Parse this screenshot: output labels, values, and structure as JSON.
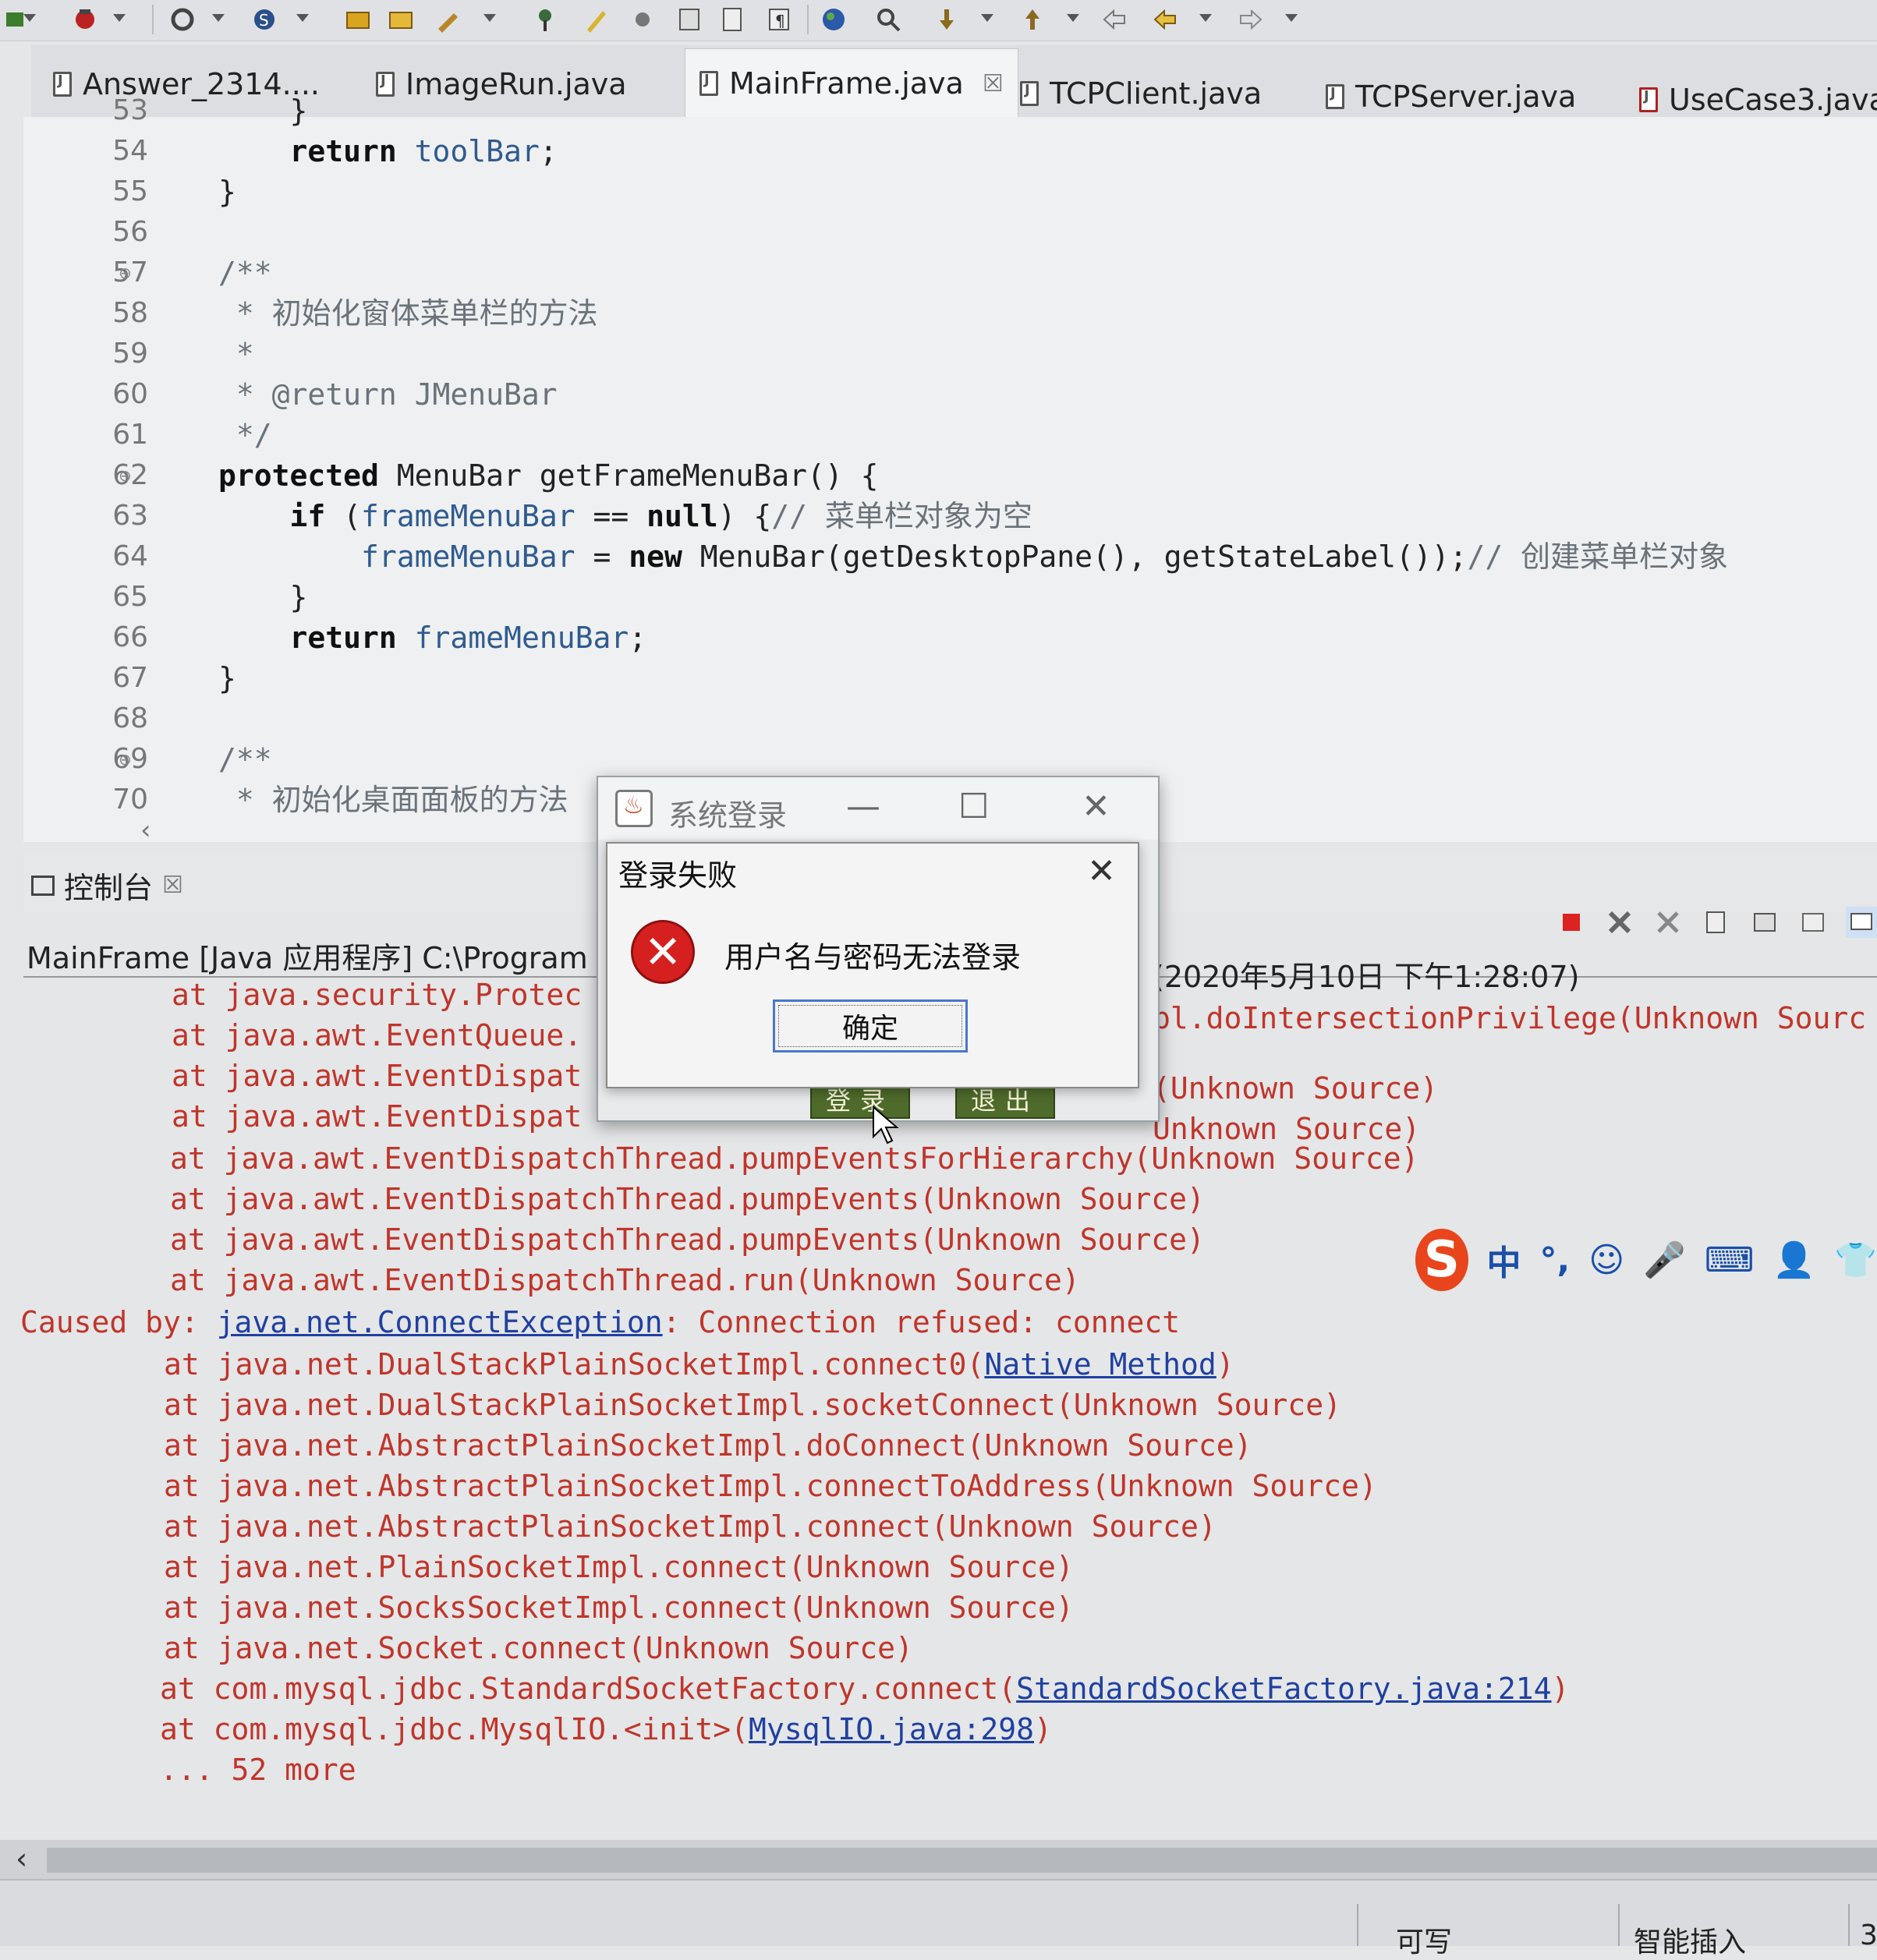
{
  "editor_tabs": [
    {
      "label": "Answer_2314....",
      "active": false
    },
    {
      "label": "ImageRun.java",
      "active": false
    },
    {
      "label": "MainFrame.java",
      "active": true,
      "close": "☒"
    },
    {
      "label": "TCPClient.java",
      "active": false
    },
    {
      "label": "TCPServer.java",
      "active": false
    },
    {
      "label": "UseCase3.java",
      "active": false
    }
  ],
  "code_lines": [
    {
      "n": "53",
      "text": "    }"
    },
    {
      "n": "54",
      "text": "    return toolBar;"
    },
    {
      "n": "55",
      "text": "}"
    },
    {
      "n": "56",
      "text": ""
    },
    {
      "n": "57",
      "text": "/**"
    },
    {
      "n": "58",
      "text": " * 初始化窗体菜单栏的方法"
    },
    {
      "n": "59",
      "text": " *"
    },
    {
      "n": "60",
      "text": " * @return JMenuBar"
    },
    {
      "n": "61",
      "text": " */"
    },
    {
      "n": "62",
      "text": "protected MenuBar getFrameMenuBar() {"
    },
    {
      "n": "63",
      "text": "    if (frameMenuBar == null) {// 菜单栏对象为空"
    },
    {
      "n": "64",
      "text": "        frameMenuBar = new MenuBar(getDesktopPane(), getStateLabel());// 创建菜单栏对象"
    },
    {
      "n": "65",
      "text": "    }"
    },
    {
      "n": "66",
      "text": "    return frameMenuBar;"
    },
    {
      "n": "67",
      "text": "}"
    },
    {
      "n": "68",
      "text": ""
    },
    {
      "n": "69",
      "text": "/**"
    },
    {
      "n": "70",
      "text": " * 初始化桌面面板的方法"
    }
  ],
  "console": {
    "tab_label": "控制台",
    "tab_close": "☒",
    "process_left": "MainFrame [Java 应用程序] C:\\Program",
    "process_right": "(2020年5月10日 下午1:28:07)",
    "lines_top": [
      {
        "left": "at java.security.Protec",
        "right": "pl.doIntersectionPrivilege(Unknown Sourc"
      },
      {
        "left": "at java.awt.EventQueue.",
        "right": ""
      },
      {
        "left": "at java.awt.EventDispat",
        "right": "(Unknown Source)"
      },
      {
        "left": "at java.awt.EventDispat",
        "right": "Unknown Source)"
      }
    ],
    "lines": [
      "at java.awt.EventDispatchThread.pumpEventsForHierarchy(Unknown Source)",
      "at java.awt.EventDispatchThread.pumpEvents(Unknown Source)",
      "at java.awt.EventDispatchThread.pumpEvents(Unknown Source)",
      "at java.awt.EventDispatchThread.run(Unknown Source)"
    ],
    "caused_by": {
      "prefix": "Caused by: ",
      "exception": "java.net.ConnectException",
      "message": ": Connection refused: connect"
    },
    "stack": [
      {
        "text": "at java.net.DualStackPlainSocketImpl.connect0(",
        "link": "Native Method",
        "suffix": ")"
      },
      {
        "text": "at java.net.DualStackPlainSocketImpl.socketConnect(Unknown Source)",
        "link": "",
        "suffix": ""
      },
      {
        "text": "at java.net.AbstractPlainSocketImpl.doConnect(Unknown Source)",
        "link": "",
        "suffix": ""
      },
      {
        "text": "at java.net.AbstractPlainSocketImpl.connectToAddress(Unknown Source)",
        "link": "",
        "suffix": ""
      },
      {
        "text": "at java.net.AbstractPlainSocketImpl.connect(Unknown Source)",
        "link": "",
        "suffix": ""
      },
      {
        "text": "at java.net.PlainSocketImpl.connect(Unknown Source)",
        "link": "",
        "suffix": ""
      },
      {
        "text": "at java.net.SocksSocketImpl.connect(Unknown Source)",
        "link": "",
        "suffix": ""
      },
      {
        "text": "at java.net.Socket.connect(Unknown Source)",
        "link": "",
        "suffix": ""
      },
      {
        "text": "at com.mysql.jdbc.StandardSocketFactory.connect(",
        "link": "StandardSocketFactory.java:214",
        "suffix": ")"
      },
      {
        "text": "at com.mysql.jdbc.MysqlIO.<init>(",
        "link": "MysqlIO.java:298",
        "suffix": ")"
      },
      {
        "text": "... 52 more",
        "link": "",
        "suffix": ""
      }
    ]
  },
  "login_window": {
    "title": "系统登录",
    "minimize": "—",
    "maximize": "☐",
    "close": "✕",
    "login_button": "登录",
    "exit_button": "退出"
  },
  "error_dialog": {
    "title": "登录失败",
    "close": "✕",
    "icon": "error-icon",
    "message": "用户名与密码无法登录",
    "ok_label": "确定"
  },
  "ime": {
    "logo": "S",
    "lang": "中",
    "punct": "°,",
    "emoji": "☺",
    "mic": "🎤",
    "keyboard": "⌨",
    "user": "👤",
    "skin": "👕"
  },
  "status_bar": {
    "writable": "可写",
    "insert_mode": "智能插入",
    "position": "3"
  },
  "colors": {
    "error_red": "#c0352a",
    "link_blue": "#2040a0",
    "button_green": "#4f6b2b",
    "ime_orange": "#e8451d"
  }
}
